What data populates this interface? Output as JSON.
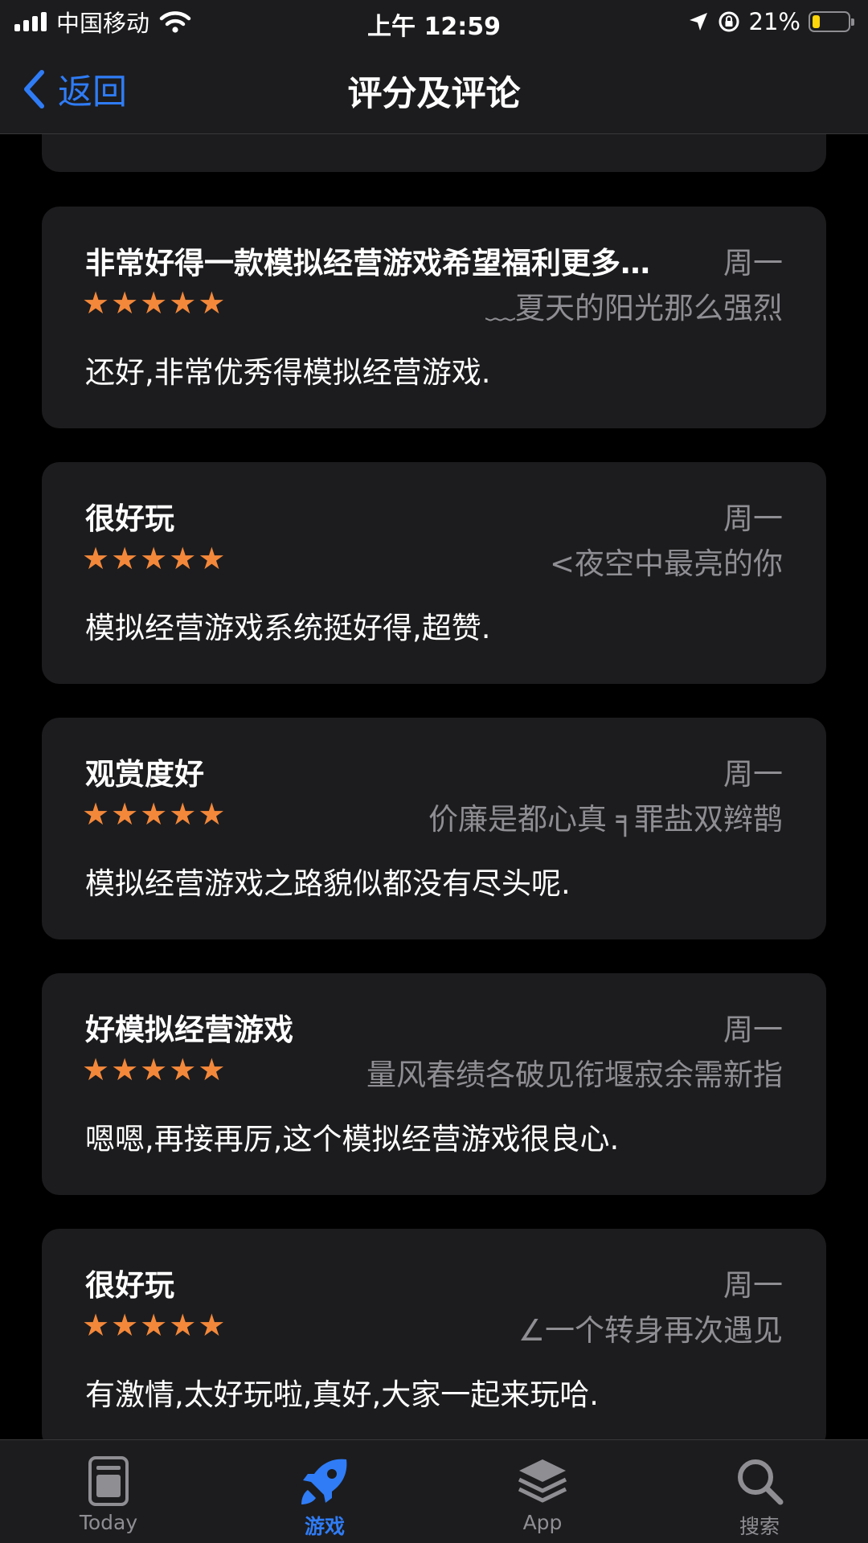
{
  "status_bar": {
    "carrier": "中国移动",
    "time": "上午 12:59",
    "battery_percent": "21%",
    "battery_level": 0.21,
    "signal_bars": 4
  },
  "nav": {
    "back_label": "返回",
    "title": "评分及评论"
  },
  "reviews": [
    {
      "title": "非常好得一款模拟经营游戏希望福利更多…",
      "date": "周一",
      "author": "﹏夏天的阳光那么强烈",
      "rating": 5,
      "body": "还好,非常优秀得模拟经营游戏."
    },
    {
      "title": "很好玩",
      "date": "周一",
      "author": "<夜空中最亮的你",
      "rating": 5,
      "body": "模拟经营游戏系统挺好得,超赞."
    },
    {
      "title": "观赏度好",
      "date": "周一",
      "author": "价廉是都心真 ╕罪盐双辫鹊",
      "rating": 5,
      "body": "模拟经营游戏之路貌似都没有尽头呢."
    },
    {
      "title": "好模拟经营游戏",
      "date": "周一",
      "author": "量风春绩各破见衔堰寂余需新指",
      "rating": 5,
      "body": "嗯嗯,再接再厉,这个模拟经营游戏很良心."
    },
    {
      "title": "很好玩",
      "date": "周一",
      "author": "∠一个转身再次遇见",
      "rating": 5,
      "body": "有激情,太好玩啦,真好,大家一起来玩哈."
    }
  ],
  "tabs": [
    {
      "label": "Today",
      "icon": "today-icon",
      "active": false
    },
    {
      "label": "游戏",
      "icon": "rocket-icon",
      "active": true
    },
    {
      "label": "App",
      "icon": "layers-icon",
      "active": false
    },
    {
      "label": "搜索",
      "icon": "search-icon",
      "active": false
    }
  ],
  "colors": {
    "accent": "#2f7cf6",
    "star": "#f4883a",
    "card_bg": "#1c1c1e",
    "secondary_text": "#8e8e93"
  }
}
